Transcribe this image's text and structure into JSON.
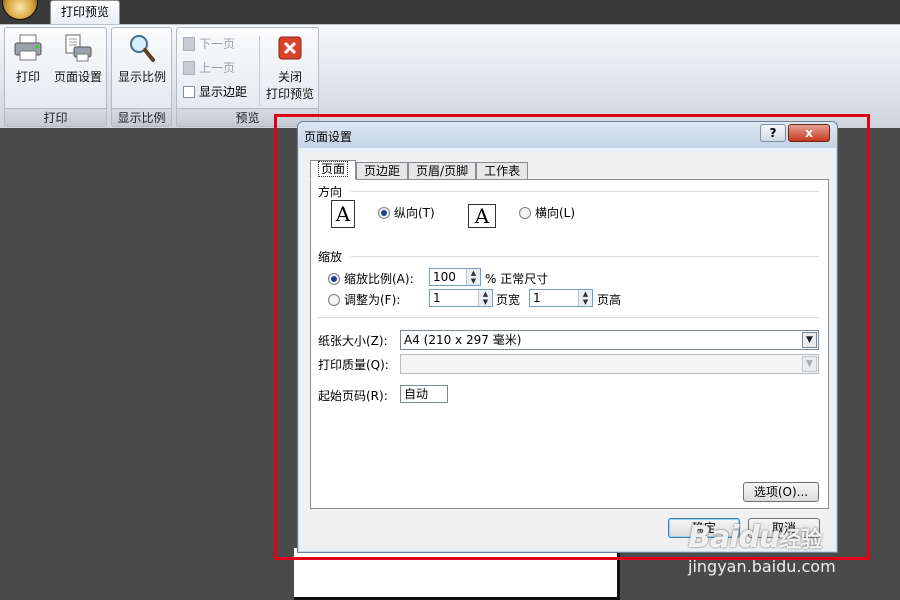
{
  "window": {
    "tab_label": "打印预览"
  },
  "ribbon": {
    "groups": [
      {
        "label": "打印",
        "buttons": [
          "打印",
          "页面设置"
        ]
      },
      {
        "label": "显示比例",
        "buttons": [
          "显示比例"
        ]
      },
      {
        "label": "预览",
        "buttons": [
          "下一页",
          "上一页",
          "显示边距"
        ],
        "close_line1": "关闭",
        "close_line2": "打印预览"
      }
    ]
  },
  "dialog": {
    "title": "页面设置",
    "help": "?",
    "close": "x",
    "tabs": [
      "页面",
      "页边距",
      "页眉/页脚",
      "工作表"
    ],
    "orientation": {
      "label": "方向",
      "portrait": "纵向(T)",
      "landscape": "横向(L)",
      "selected": "portrait",
      "icon_letter": "A"
    },
    "scaling": {
      "label": "缩放",
      "adjust_label": "缩放比例(A):",
      "adjust_value": "100",
      "adjust_suffix": "% 正常尺寸",
      "fit_label": "调整为(F):",
      "fit_wide_value": "1",
      "fit_wide_suffix": "页宽",
      "fit_tall_value": "1",
      "fit_tall_suffix": "页高",
      "selected": "adjust"
    },
    "paper_size": {
      "label": "纸张大小(Z):",
      "value": "A4 (210 x 297 毫米)"
    },
    "print_quality": {
      "label": "打印质量(Q):",
      "value": ""
    },
    "first_page": {
      "label": "起始页码(R):",
      "value": "自动"
    },
    "options_button": "选项(O)...",
    "ok_button": "确定",
    "cancel_button": "取消"
  },
  "watermark": {
    "brand": "Baidu",
    "brand_suffix": "经验",
    "url": "jingyan.baidu.com"
  },
  "colors": {
    "highlight": "#e0001a",
    "workspace": "#4a4a4a"
  }
}
